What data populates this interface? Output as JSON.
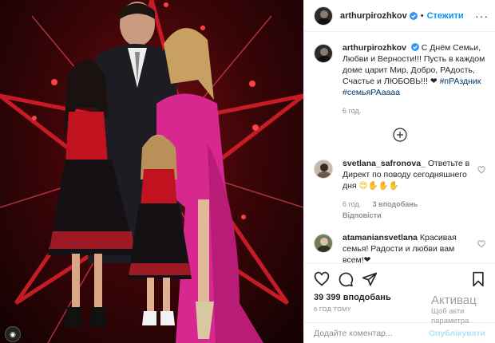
{
  "post": {
    "author": "arthurpirozhkov",
    "follow_label": "Стежити",
    "dot": "•",
    "more_label": "···",
    "caption_user": "arthurpirozhkov",
    "caption_text": "С Днём Семьи, Любви и Верности!!! Пусть в каждом доме царит Мир, Добро, РАдость, Счастье и ЛЮБОВЬ!!! ❤",
    "caption_hashtags": "#пРАздник #семьяРАаааа",
    "caption_time": "6 год.",
    "likes": "39 399 вподобань",
    "time_ago": "6 ГОД ТОМУ",
    "add_comment_placeholder": "Додайте коментар...",
    "publish_label": "Опублікувати"
  },
  "comments": [
    {
      "user": "svetlana_safronova_",
      "text": "Ответьте в Директ по поводу сегодняшнего дня",
      "emoji": "😍✋✋✋",
      "time": "6 год.",
      "likes": "3 вподобань",
      "reply": "Відповісти"
    },
    {
      "user": "atamaniansvetlana",
      "text": "Красивая семья! Радости и любви вам всем!❤"
    }
  ],
  "watermark": {
    "title": "Активац",
    "line1": "Щоб акти",
    "line2": "параметра"
  },
  "icons": {
    "like": "heart-icon",
    "comment": "comment-icon",
    "share": "paper-plane-icon",
    "save": "bookmark-icon",
    "more_comments": "plus-circle-icon",
    "verified": "verified-badge-icon"
  },
  "colors": {
    "accent": "#0095f6",
    "like_red": "#ed4956",
    "photo_red": "#c1121f",
    "dress_pink": "#d6288f"
  }
}
